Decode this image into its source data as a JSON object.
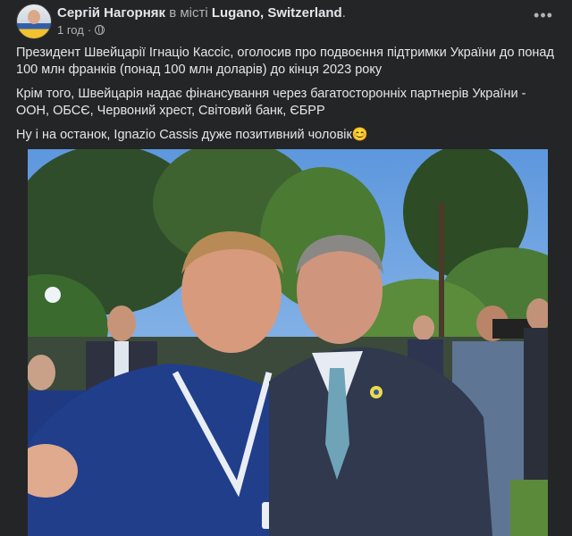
{
  "post": {
    "author": "Сергій Нагорняк",
    "location_prefix": "в місті",
    "location": "Lugano, Switzerland",
    "location_suffix": ".",
    "time": "1 год",
    "time_separator": "·",
    "more_label": "•••",
    "paragraphs": [
      "Президент Швейцарії Ігнаціо Кассіс, оголосив про подвоєння підтримки України до понад 100 млн франків (понад 100 млн доларів) до кінця 2023 року",
      "Крім того, Швейцарія надає фінансування через багатосторонніх партнерів України - ООН, ОБСЄ, Червоний хрест, Світовий банк, ЄБРР",
      "Ну і на останок, Ignazio Cassis дуже позитивний чоловік😊"
    ]
  },
  "icons": {
    "avatar": "profile-avatar",
    "privacy": "globe-icon",
    "menu": "more-options-icon"
  },
  "colors": {
    "background": "#18191a",
    "card": "#242526",
    "text_primary": "#e4e6eb",
    "text_secondary": "#b0b3b8"
  }
}
